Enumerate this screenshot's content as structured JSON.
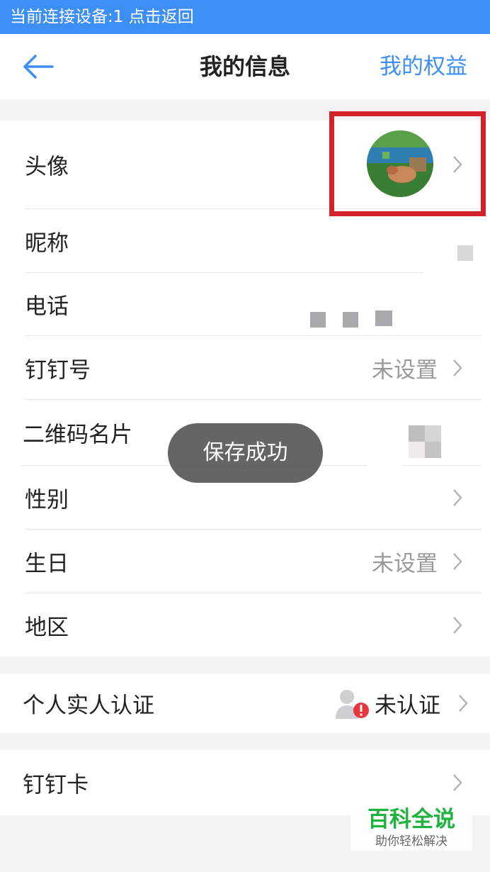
{
  "status_bar": {
    "text": "当前连接设备:1  点击返回"
  },
  "header": {
    "title": "我的信息",
    "right_link": "我的权益"
  },
  "rows": {
    "avatar": {
      "label": "头像"
    },
    "nickname": {
      "label": "昵称"
    },
    "phone": {
      "label": "电话"
    },
    "dingtalk_id": {
      "label": "钉钉号",
      "value": "未设置"
    },
    "qrcode": {
      "label": "二维码名片"
    },
    "gender": {
      "label": "性别"
    },
    "birthday": {
      "label": "生日",
      "value": "未设置"
    },
    "region": {
      "label": "地区"
    },
    "realname": {
      "label": "个人实人认证",
      "value": "未认证"
    },
    "dingcard": {
      "label": "钉钉卡"
    }
  },
  "toast": {
    "text": "保存成功"
  },
  "watermark": {
    "title": "百科全说",
    "subtitle": "助你轻松解决"
  },
  "colors": {
    "accent": "#3e8ff5",
    "highlight": "#d2232a",
    "watermark": "#1db33c"
  },
  "icons": [
    "back-arrow-icon",
    "chevron-right-icon",
    "verify-person-icon"
  ]
}
